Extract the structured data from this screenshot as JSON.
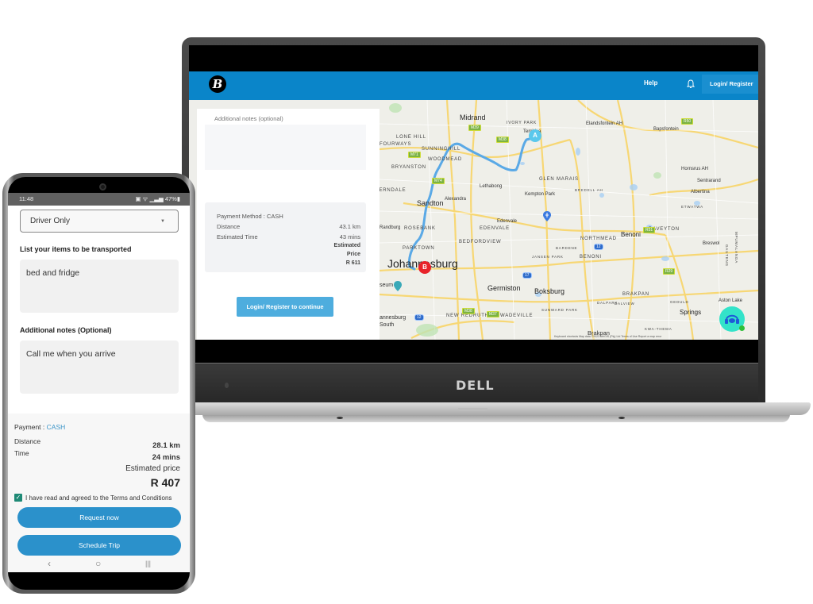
{
  "laptop": {
    "brand": "DELL",
    "header": {
      "logo": "B",
      "help_label": "Help",
      "login_label": "Login/ Register"
    },
    "form": {
      "notes_label": "Additional notes (optional)",
      "notes_value": "",
      "summary": {
        "payment_label": "Payment Method : CASH",
        "distance_label": "Distance",
        "distance_value": "43.1 km",
        "time_label": "Estimated Time",
        "time_value": "43 mins",
        "price_label_1": "Estimated",
        "price_label_2": "Price",
        "price_value": "R 611"
      },
      "continue_label": "Login/ Register to continue"
    },
    "map": {
      "marker_a": "A",
      "marker_b": "B",
      "footer": "Keyboard shortcuts   Map data ©2023 AfriGIS (Pty) Ltd   Terms of Use   Report a map error",
      "labels": {
        "midrand": "Midrand",
        "ivory_park": "IVORY PARK",
        "tembisa": "Tembisa",
        "lone_hill": "LONE HILL",
        "fourways": "FOURWAYS",
        "sunninghill": "SUNNINGHILL",
        "woodmead": "WOODMEAD",
        "bryanston": "BRYANSTON",
        "ferndale": "FERNDALE",
        "sandton": "Sandton",
        "alexandra": "Alexandra",
        "lethabong": "Lethabong",
        "glen_marais": "GLEN MARAIS",
        "kempton_park": "Kempton Park",
        "bredell": "BREDELL AH",
        "randburg": "Randburg",
        "rosebank": "ROSEBANK",
        "edenvale_town": "Edenvale",
        "edenvale": "EDENVALE",
        "bedfordview": "BEDFORDVIEW",
        "parktown": "PARKTOWN",
        "johannesburg": "Johannesburg",
        "museum": "seum",
        "germiston": "Germiston",
        "boksburg": "Boksburg",
        "jansen_park": "JANSEN PARK",
        "barden": "BARDENE",
        "johannesburg_south": "annesburg South",
        "new_redruth": "NEW REDRUTH",
        "wadeville": "WADEVILLE",
        "sunward_park": "SUNWARD PARK",
        "elandsfontein": "Elandsfontein AH",
        "bapsfontein": "Bapsfontein",
        "hornsrus": "Hornsrus AH",
        "sentrarand": "Sentrarand",
        "albertina": "Albertina",
        "etwatwa": "ETWATWA",
        "northmead": "NORTHMEAD",
        "benoni": "Benoni",
        "benoni_caps": "BENONI",
        "daveyton": "DAVEYTON",
        "breswol": "Breswol",
        "gauteng": "GAUTENG",
        "mpumalanga": "MPUMALANGA",
        "brakpan_caps": "BRAKPAN",
        "brakpan": "Brakpan",
        "dalpark": "DALPARK",
        "dalview": "DALVIEW",
        "geduld": "GEDULD",
        "springs": "Springs",
        "aston_lake": "Aston Lake",
        "kwa_thema": "KWA-THEMA"
      }
    }
  },
  "phone": {
    "status": {
      "time": "11:48",
      "battery": "47%"
    },
    "driver_select": "Driver Only",
    "items_label": "List your items to be transported",
    "items_value": "bed and fridge",
    "notes_label": "Additional notes (Optional)",
    "notes_value": "Call me when you arrive",
    "summary": {
      "payment_label": "Payment :",
      "payment_value": "CASH",
      "distance_label": "Distance",
      "distance_value": "28.1 km",
      "time_label": "Time",
      "time_value": "24 mins",
      "price_label": "Estimated price",
      "price_value": "R 407"
    },
    "terms_checked": true,
    "terms_label": "I have read and agreed to the Terms and Conditions",
    "request_label": "Request now",
    "schedule_label": "Schedule Trip",
    "nav": {
      "back": "‹",
      "home": "○",
      "recents": "|||"
    }
  },
  "colors": {
    "header_blue": "#0a85c9",
    "button_blue": "#2b91cb",
    "route_blue": "#5aa9e6",
    "marker_red": "#e8232a",
    "check_green": "#1f8a76"
  }
}
